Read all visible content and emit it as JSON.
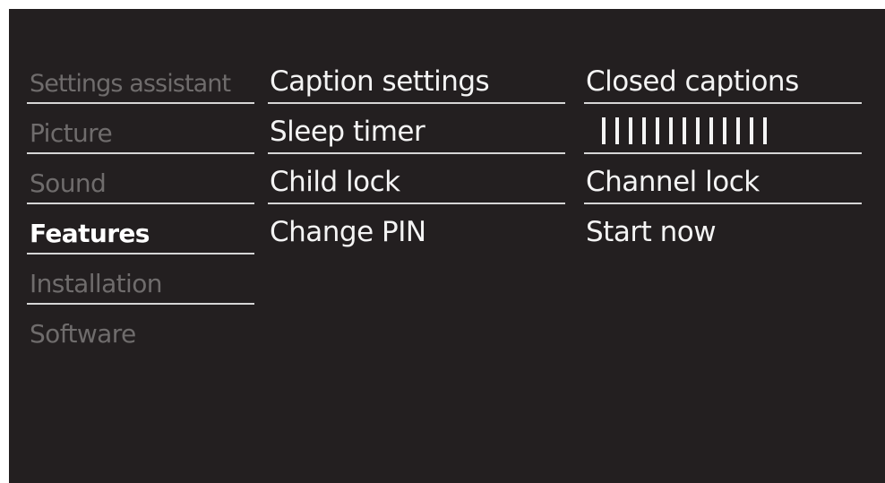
{
  "menu": {
    "main": [
      {
        "label": "Settings assistant",
        "state": "dim"
      },
      {
        "label": "Picture",
        "state": "dim"
      },
      {
        "label": "Sound",
        "state": "dim"
      },
      {
        "label": "Features",
        "state": "active"
      },
      {
        "label": "Installation",
        "state": "dim"
      },
      {
        "label": "Software",
        "state": "dim"
      }
    ],
    "features": [
      {
        "label": "Caption settings"
      },
      {
        "label": "Sleep timer"
      },
      {
        "label": "Child lock"
      },
      {
        "label": "Change PIN"
      }
    ],
    "values": [
      {
        "label": "Closed captions"
      },
      {
        "type": "slider",
        "segments": 13
      },
      {
        "label": "Channel lock"
      },
      {
        "label": "Start now"
      }
    ]
  },
  "colors": {
    "background": "#231f20",
    "text": "#f4f4f4",
    "dim_text": "#6f6c6c",
    "divider": "#d6d6d6"
  }
}
